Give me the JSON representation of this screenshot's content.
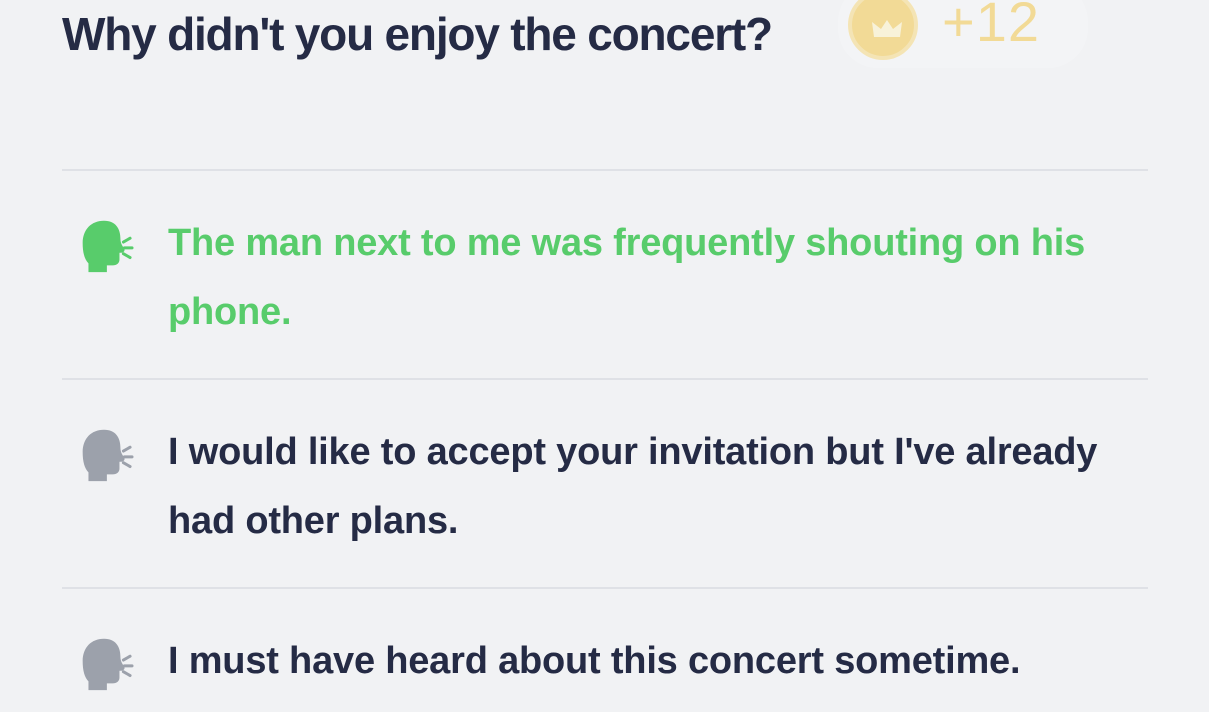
{
  "question": {
    "title": "Why didn't you enjoy the concert?"
  },
  "reward": {
    "points_text": "+12",
    "icon": "crown-coin-icon"
  },
  "options": [
    {
      "text": "The man next to me was frequently shouting on his phone.",
      "selected": true,
      "icon": "speaking-head-icon",
      "color": "#58cc6b"
    },
    {
      "text": "I would like to accept your invitation but I've already had other plans.",
      "selected": false,
      "icon": "speaking-head-icon",
      "color": "#9ca1ab"
    },
    {
      "text": "I must have heard about this concert sometime.",
      "selected": false,
      "icon": "speaking-head-icon",
      "color": "#9ca1ab"
    }
  ],
  "colors": {
    "background": "#f1f2f4",
    "title": "#252b45",
    "selected": "#58cc6b",
    "icon_inactive": "#9ca1ab",
    "divider": "#dfe1e6",
    "reward": "#f3c84b"
  }
}
